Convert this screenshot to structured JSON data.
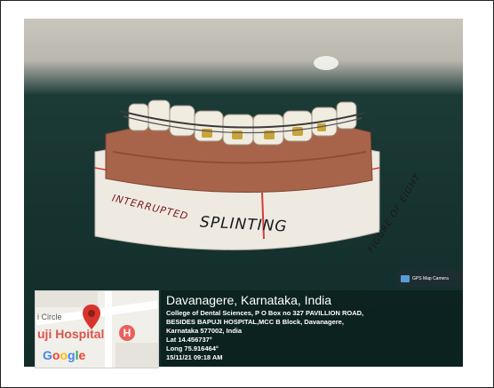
{
  "photo": {
    "subject": "dental cast with splinted teeth",
    "label_main": "SPLINTING",
    "label_left": "INTERRUPTED",
    "label_right": "FIGURE OF EIGHT"
  },
  "badge": {
    "text": "GPS Map Camera",
    "icon": "camera-icon"
  },
  "map": {
    "circle_text": "i Circle",
    "hospital_text": "uji Hospital",
    "marker_letter": "H",
    "provider": "Google",
    "pin_icon": "location-pin-icon"
  },
  "location": {
    "city": "Davanagere, Karnataka, India",
    "address_line1": "College of Dental Sciences, P O Box no 327 PAVILLION ROAD,",
    "address_line2": "BESIDES BAPUJI HOSPITAL,MCC B Block, Davanagere,",
    "address_line3": "Karnataka 577002, India",
    "lat": "Lat 14.456737°",
    "long": "Long 75.916464°",
    "datetime": "15/11/21 09:18 AM"
  },
  "colors": {
    "table": "#16332f",
    "cast": "#a8644a",
    "overlay": "#0a1e1c",
    "pin": "#d9342b"
  }
}
